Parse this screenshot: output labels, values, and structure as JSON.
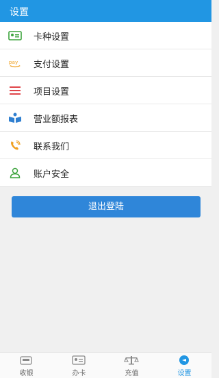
{
  "header": {
    "title": "设置"
  },
  "menu": {
    "items": [
      {
        "label": "卡种设置",
        "icon": "card-icon"
      },
      {
        "label": "支付设置",
        "icon": "pay-icon"
      },
      {
        "label": "项目设置",
        "icon": "list-icon"
      },
      {
        "label": "营业额报表",
        "icon": "report-icon"
      },
      {
        "label": "联系我们",
        "icon": "phone-icon"
      },
      {
        "label": "账户安全",
        "icon": "user-icon"
      }
    ]
  },
  "logout": {
    "label": "退出登陆"
  },
  "bottom_nav": {
    "items": [
      {
        "label": "收银"
      },
      {
        "label": "办卡"
      },
      {
        "label": "充值"
      },
      {
        "label": "设置"
      }
    ]
  },
  "colors": {
    "header": "#2196e3",
    "button": "#2f86d9"
  }
}
